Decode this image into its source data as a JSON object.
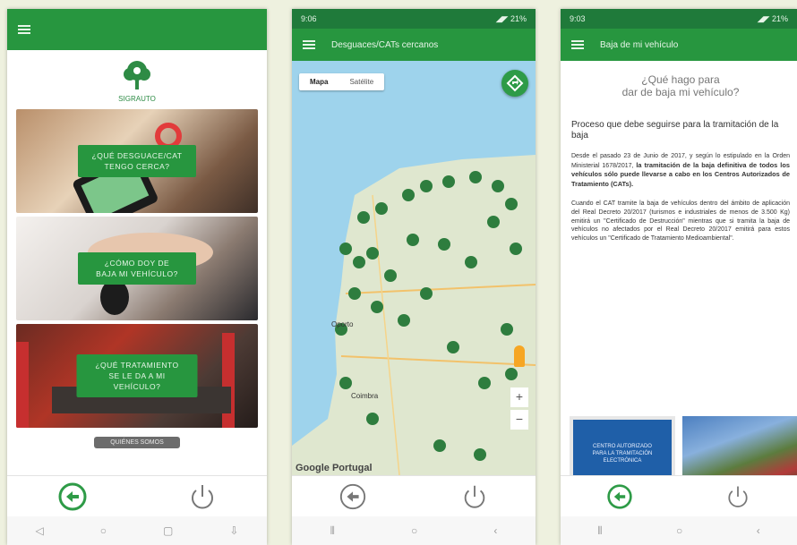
{
  "phone1": {
    "logo_text": "SIGRAUTO",
    "tiles": [
      {
        "label": "¿QUÉ DESGUACE/CAT\nTENGO CERCA?"
      },
      {
        "label": "¿CÓMO DOY DE\nBAJA MI VEHÍCULO?"
      },
      {
        "label": "¿QUÉ TRATAMIENTO\nSE LE DA A MI VEHÍCULO?"
      }
    ],
    "about_label": "QUIÉNES SOMOS"
  },
  "phone2": {
    "status_time": "9:06",
    "status_right": "◢◤ 21%",
    "title": "Desguaces/CATs cercanos",
    "map_tab_active": "Mapa",
    "map_tab_other": "Satélite",
    "city_1": "Oporto",
    "city_2": "Coimbra",
    "map_brand": "Google",
    "map_brand_2": "Portugal"
  },
  "phone3": {
    "status_time": "9:03",
    "status_right": "◢◤ 21%",
    "title": "Baja de mi vehículo",
    "question": "¿Qué hago para\ndar de baja mi vehículo?",
    "process_title": "Proceso que debe seguirse para la tramitación de la baja",
    "para1_a": "Desde el pasado 23 de Junio de 2017, y según lo estipulado en la Orden Ministerial 1678/2017,",
    "para1_b": "la tramitación de la baja definitiva de todos los vehículos sólo puede llevarse a cabo en los Centros Autorizados de Tratamiento (CATs).",
    "para2": "Cuando el CAT tramite la baja de vehículos dentro del ámbito de aplicación del Real Decreto 20/2017 (turismos e industriales de menos de 3.500 Kg) emitirá un \"Certificado de Destrucción\" mientras que si tramita la baja de vehículos no afectados por el Real Decreto 20/2017 emitirá para estos vehículos un \"Certificado de Tratamiento Medioambiental\".",
    "sign_text": "CENTRO AUTORIZADO\nPARA LA TRAMITACIÓN\nELECTRÓNICA"
  },
  "colors": {
    "appbar": "#27963f",
    "status": "#1f7a3a",
    "accent": "#2e9b47"
  }
}
